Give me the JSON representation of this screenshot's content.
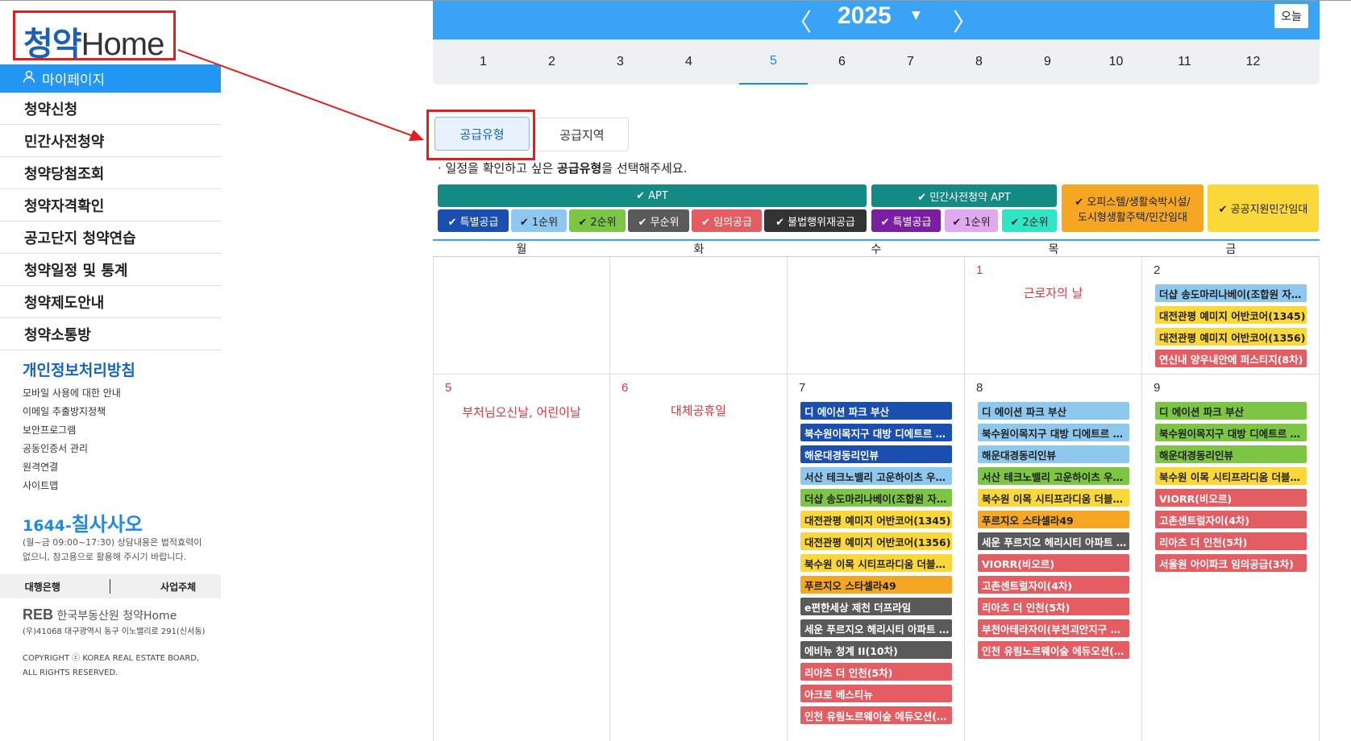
{
  "sidebar": {
    "logo": {
      "prefix": "청약",
      "suffix": "Home"
    },
    "mypage": "마이페이지",
    "nav": [
      "청약신청",
      "민간사전청약",
      "청약당첨조회",
      "청약자격확인",
      "공고단지 청약연습",
      "청약일정 및 통계",
      "청약제도안내",
      "청약소통방"
    ],
    "privacy": "개인정보처리방침",
    "links": [
      "모바일 사용에 대한 안내",
      "이메일 추출방지정책",
      "보안프로그램",
      "공동인증서 관리",
      "원격연결",
      "사이트맵"
    ],
    "phone_prefix": "1644-",
    "phone": "칠사사오",
    "hours": "(월~금 09:00~17:30) 상담내용은 법적효력이 없으니, 참고용으로 활용해 주시기 바랍니다.",
    "bank": "대행은행",
    "business": "사업주체",
    "footer_logo": "REB",
    "footer_org": "한국부동산원 청약Home",
    "address": "(우)41068 대구광역시 동구 이노밸리로 291(신서동)",
    "copyright": "COPYRIGHT ⓒ KOREA REAL ESTATE BOARD, ALL RIGHTS RESERVED."
  },
  "yearbar": {
    "prev": "〈",
    "year": "2025",
    "next": "〉",
    "today": "오늘",
    "drop": "▼"
  },
  "months": [
    "1",
    "2",
    "3",
    "4",
    "5",
    "6",
    "7",
    "8",
    "9",
    "10",
    "11",
    "12"
  ],
  "active_month": "5",
  "tabs": {
    "type": "공급유형",
    "region": "공급지역"
  },
  "instruction": {
    "pre": "· 일정을 확인하고 싶은 ",
    "bold": "공급유형",
    "post": "을 선택해주세요."
  },
  "legend": {
    "apt": "✔ APT",
    "private": "✔ 민간사전청약 APT",
    "officetel": "✔ 오피스텔/생활숙박시설/\n도시형생활주택/민간임대",
    "public": "✔ 공공지원민간임대",
    "apt_items": [
      "✔ 특별공급",
      "✔ 1순위",
      "✔ 2순위",
      "✔ 무순위",
      "✔ 임의공급",
      "✔ 불법행위재공급"
    ],
    "private_items": [
      "✔ 특별공급",
      "✔ 1순위",
      "✔ 2순위"
    ]
  },
  "colors": {
    "accent": "#3ba3f5",
    "special": "#1a4fb0",
    "first": "#8ec8ee",
    "second": "#7dc545",
    "nonrank": "#5a5a5a",
    "random": "#e35d63",
    "illegal": "#333333",
    "officetel": "#f5a623",
    "public": "#fbd83a",
    "private_special": "#7b1fa2",
    "private_first": "#e1a9ef",
    "private_second": "#2ee6c6"
  },
  "weekdays": [
    "월",
    "화",
    "수",
    "목",
    "금"
  ],
  "calendar": {
    "week1": {
      "thu": {
        "day": "1",
        "holiday": "근로자의 날"
      },
      "fri": {
        "day": "2",
        "events": [
          {
            "text": "더샵 송도마리나베이(조합원 자…",
            "kind": "first"
          },
          {
            "text": "대전관평 예미지 어반코어(1345)",
            "kind": "public"
          },
          {
            "text": "대전관평 예미지 어반코어(1356)",
            "kind": "public"
          },
          {
            "text": "연신내 양우내안에 퍼스티지(8차)",
            "kind": "random"
          }
        ]
      }
    },
    "week2": {
      "mon": {
        "day": "5",
        "holiday": "부처님오신날, 어린이날"
      },
      "tue": {
        "day": "6",
        "holiday": "대체공휴일"
      },
      "wed": {
        "day": "7",
        "events": [
          {
            "text": "디 에이션 파크 부산",
            "kind": "special"
          },
          {
            "text": "북수원이목지구 대방 디에트르 …",
            "kind": "special"
          },
          {
            "text": "해운대경동리인뷰",
            "kind": "special"
          },
          {
            "text": "서산 테크노밸리 고운하이츠 우…",
            "kind": "first"
          },
          {
            "text": "더샵 송도마리나베이(조합원 자…",
            "kind": "second"
          },
          {
            "text": "대전관평 예미지 어반코어(1345)",
            "kind": "public"
          },
          {
            "text": "대전관평 예미지 어반코어(1356)",
            "kind": "public"
          },
          {
            "text": "북수원 이목 시티프라디움 더블…",
            "kind": "public"
          },
          {
            "text": "푸르지오 스타셀라49",
            "kind": "officetel"
          },
          {
            "text": "e편한세상 제천 더프라임",
            "kind": "nonrank"
          },
          {
            "text": "세운 푸르지오 헤리시티 아파트 …",
            "kind": "nonrank"
          },
          {
            "text": "에비뉴 청계 II(10차)",
            "kind": "nonrank"
          },
          {
            "text": "리아츠 더 인천(5차)",
            "kind": "random"
          },
          {
            "text": "아크로 베스티뉴",
            "kind": "random"
          },
          {
            "text": "인천 유림노르웨이숲 에듀오션(…",
            "kind": "random"
          }
        ]
      },
      "thu": {
        "day": "8",
        "events": [
          {
            "text": "디 에이션 파크 부산",
            "kind": "first"
          },
          {
            "text": "북수원이목지구 대방 디에트르 …",
            "kind": "first"
          },
          {
            "text": "해운대경동리인뷰",
            "kind": "first"
          },
          {
            "text": "서산 테크노밸리 고운하이츠 우…",
            "kind": "second"
          },
          {
            "text": "북수원 이목 시티프라디움 더블…",
            "kind": "public"
          },
          {
            "text": "푸르지오 스타셀라49",
            "kind": "officetel"
          },
          {
            "text": "세운 푸르지오 헤리시티 아파트 …",
            "kind": "nonrank"
          },
          {
            "text": "VIORR(비오르)",
            "kind": "random"
          },
          {
            "text": "고촌센트럴자이(4차)",
            "kind": "random"
          },
          {
            "text": "리아츠 더 인천(5차)",
            "kind": "random"
          },
          {
            "text": "부천아테라자이(부천괴안지구 …",
            "kind": "random"
          },
          {
            "text": "인천 유림노르웨이숲 에듀오션(…",
            "kind": "random"
          }
        ]
      },
      "fri": {
        "day": "9",
        "events": [
          {
            "text": "디 에이션 파크 부산",
            "kind": "second"
          },
          {
            "text": "북수원이목지구 대방 디에트르 …",
            "kind": "second"
          },
          {
            "text": "해운대경동리인뷰",
            "kind": "second"
          },
          {
            "text": "북수원 이목 시티프라디움 더블…",
            "kind": "public"
          },
          {
            "text": "VIORR(비오르)",
            "kind": "random"
          },
          {
            "text": "고촌센트럴자이(4차)",
            "kind": "random"
          },
          {
            "text": "리아츠 더 인천(5차)",
            "kind": "random"
          },
          {
            "text": "서울원 아이파크 임의공급(3차)",
            "kind": "random"
          }
        ]
      }
    }
  }
}
